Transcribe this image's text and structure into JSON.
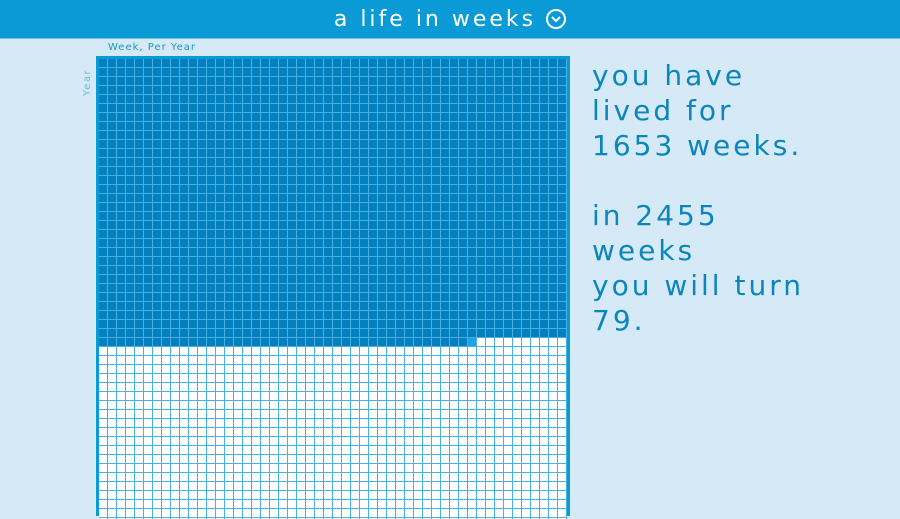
{
  "header": {
    "title": "a life in weeks",
    "menu_icon": "chevron-down-circle-icon"
  },
  "grid": {
    "x_axis_label": "Week, Per Year",
    "y_axis_label": "Year",
    "weeks_per_year": 52,
    "weeks_lived": 1653,
    "colors": {
      "lived": "#0380bd",
      "current": "#1aa3e6",
      "future": "#ffffff",
      "lines": "#45b0e6"
    }
  },
  "message": {
    "lines_1": [
      "you have",
      "lived for",
      "1653 weeks."
    ],
    "lines_2": [
      "in 2455",
      "weeks",
      "you will turn",
      "79."
    ]
  }
}
